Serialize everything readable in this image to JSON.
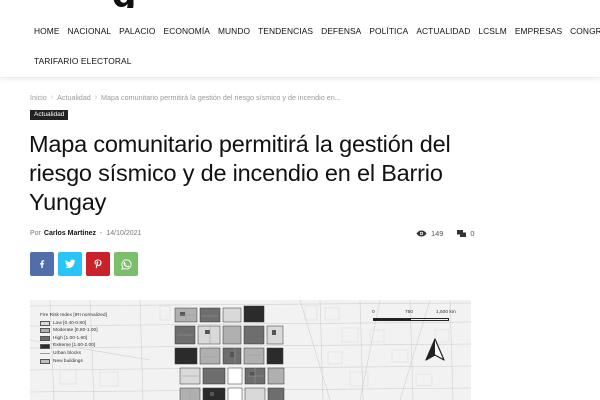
{
  "logo": {
    "partial_text": "g"
  },
  "nav": {
    "row1": [
      "HOME",
      "NACIONAL",
      "PALACIO",
      "ECONOMÍA",
      "MUNDO",
      "TENDENCIAS",
      "DEFENSA",
      "POLÍTICA",
      "ACTUALIDAD",
      "LCSLM",
      "EMPRESAS",
      "CONGRESO"
    ],
    "row2": [
      "TARIFARIO ELECTORAL"
    ]
  },
  "breadcrumb": {
    "items": [
      "Inicio",
      "Actualidad",
      "Mapa comunitario permitirá la gestión del riesgo sísmico y de incendio en..."
    ],
    "separator": "›"
  },
  "category": "Actualidad",
  "article": {
    "title": "Mapa comunitario permitirá la gestión del riesgo sísmico y de incendio en el Barrio Yungay",
    "by_label": "Por",
    "author": "Carlos Martínez",
    "date_sep": "-",
    "date": "14/10/2021",
    "views": "149",
    "comments": "0"
  },
  "share": [
    {
      "name": "facebook",
      "icon": "facebook-icon",
      "color": "#516eab"
    },
    {
      "name": "twitter",
      "icon": "twitter-icon",
      "color": "#29c5f6"
    },
    {
      "name": "pinterest",
      "icon": "pinterest-icon",
      "color": "#ca212a"
    },
    {
      "name": "whatsapp",
      "icon": "whatsapp-icon",
      "color": "#7bbf6a"
    }
  ],
  "map": {
    "legend_title": "Fire Risk Index [IRI normalized]",
    "legend_items": [
      {
        "label": "Low [0.40-0.80]",
        "color": "#d9d9d9"
      },
      {
        "label": "Moderate [0.80-1.00]",
        "color": "#b0b0b0"
      },
      {
        "label": "High [1.00-1.60]",
        "color": "#6e6e6e"
      },
      {
        "label": "Extreme [1.60-2.00]",
        "color": "#2b2b2b"
      }
    ],
    "urban_blocks_label": "Urban blocks",
    "new_buildings_label": "New buildings",
    "scale_labels": [
      "0",
      "750",
      "1,500 km"
    ]
  },
  "colors": {
    "accent": "#222222",
    "text": "#111111",
    "muted": "#9a9a9a"
  }
}
